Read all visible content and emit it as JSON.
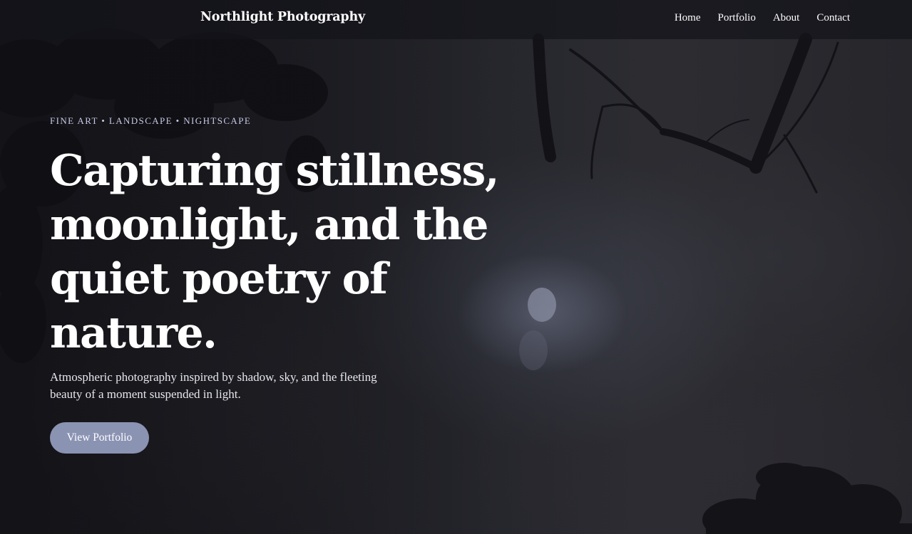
{
  "header": {
    "brand": "Northlight Photography",
    "nav": [
      {
        "label": "Home"
      },
      {
        "label": "Portfolio"
      },
      {
        "label": "About"
      },
      {
        "label": "Contact"
      }
    ]
  },
  "hero": {
    "eyebrow": "FINE ART • LANDSCAPE • NIGHTSCAPE",
    "headline": "Capturing stillness, moonlight, and the quiet poetry of nature.",
    "subtext": "Atmospheric photography inspired by shadow, sky, and the fleeting beauty of a moment suspended in light.",
    "cta_label": "View Portfolio"
  },
  "colors": {
    "accent": "#8b93b3",
    "eyebrow": "#c7c9e6",
    "nav_background": "#14141a"
  }
}
